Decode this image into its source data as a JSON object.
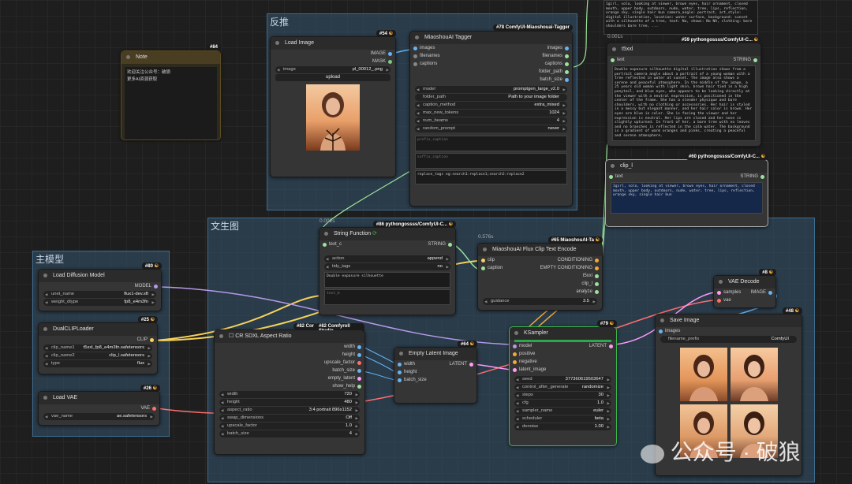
{
  "colors": {
    "group": "#34546e",
    "clip": "#f6d25a",
    "model": "#b69ae8",
    "latent": "#ff9cf9",
    "vae": "#ff6e6e",
    "string": "#9be39a",
    "image": "#64b5f6",
    "progress": "#2aa84a"
  },
  "groups": {
    "reverse": "反推",
    "txt2img": "文生图",
    "main_model": "主模型"
  },
  "note": {
    "id": "#84",
    "title": "Note",
    "line1": "欢迎关注公众号：破狼",
    "line2": "更多AI资源获取"
  },
  "load_image": {
    "id": "#54",
    "title": "Load Image",
    "out_image": "IMAGE",
    "out_mask": "MASK",
    "image_label": "image",
    "image_value": "pl_00012_.png",
    "upload": "upload"
  },
  "tagger": {
    "id": "#78 ComfyUI-Miaoshouai-Tagger",
    "title": "MiaoshouAI Tagger",
    "inputs": [
      "images",
      "filenames",
      "captions"
    ],
    "outputs": [
      "images",
      "filenames",
      "captions",
      "folder_path",
      "batch_size"
    ],
    "widgets": [
      {
        "l": "model",
        "r": "promptgen_large_v2.0"
      },
      {
        "l": "folder_path",
        "r": "Path to your image folder"
      },
      {
        "l": "caption_method",
        "r": "extra_mixed"
      },
      {
        "l": "max_new_tokens",
        "r": "1024"
      },
      {
        "l": "num_beams",
        "r": "4"
      },
      {
        "l": "random_prompt",
        "r": "never"
      }
    ],
    "prefix": "prefix_caption",
    "suffix": "suffix_caption",
    "replace": "replace_tags eg:search1:replace1;search2:replace2"
  },
  "t5xxl": {
    "time": "0.001s",
    "id": "#59 pythongossss/ComfyUI-C...",
    "title": "t5xxl",
    "in_text": "text",
    "out": "STRING",
    "top_text": "1girl, solo, looking at viewer, brown eyes, hair ornament, closed mouth, upper body, outdoors, nude, water, tree, lips, reflection, orange sky, single hair bun\n\ncamera_angle: portrait, art_style: digital illustration, location: water surface, background: sunset with a silhouette of a tree, text: No, shows: No NA, clothing: bare shoulders bare tree, ...",
    "body": "Double exposure silhouette digital illustration shows from a portrait camera angle about a portrait of a young woman with a tree reflected in water at sunset. The image also shows a serene and peaceful atmosphere. In the middle of the image, a 25 years old woman with light skin, brown hair tied in a high ponytail, and blue eyes, who appears to be looking directly at the viewer with a neutral expression, is positioned in the center of the frame. She has a slender physique and bare shoulders, with no clothing or accessories. Her hair is styled in a messy but elegant manner, and her hair color is brown. Her eyes are blue in color. She is facing the viewer and her expression is neutral. Her lips are closed and her nose is slightly upturned. In front of her, a bare tree with no leaves and no branches is reflected in the calm water. The background is a gradient of warm oranges and pinks, creating a peaceful and serene atmosphere."
  },
  "clip_l": {
    "id": "#60 pythongossss/ComfyUI-C...",
    "title": "clip_l",
    "in_text": "text",
    "out": "STRING",
    "text": "1girl, solo, looking at viewer, brown eyes, hair ornament, closed mouth, upper body, outdoors, nude, water, tree, lips, reflection, orange sky, single hair bun"
  },
  "string_fn": {
    "time": "0.002s",
    "id": "#86 pythongossss/ComfyUI-C...",
    "title": "String Function",
    "in_text": "text_c",
    "out": "STRING",
    "widgets": [
      {
        "l": "action",
        "r": "append"
      },
      {
        "l": "tidy_tags",
        "r": "no"
      }
    ],
    "text_a": "Double exposure silhouette",
    "text_b": "text_b"
  },
  "flux_encode": {
    "time": "0.576s",
    "id": "#65 MiaoshouAI-Ta",
    "title": "MiaoshouAI Flux Clip Text Encode",
    "inputs": [
      "clip",
      "caption"
    ],
    "outputs": [
      "CONDITIONING",
      "EMPTY CONDITIONING",
      "t5xxl",
      "clip_l",
      "analyze"
    ],
    "guidance_l": "guidance",
    "guidance_r": "3.5"
  },
  "load_diffusion": {
    "id": "#80",
    "title": "Load Diffusion Model",
    "out": "MODEL",
    "widgets": [
      {
        "l": "unet_name",
        "r": "flux1-dev.sft"
      },
      {
        "l": "weight_dtype",
        "r": "fp8_e4m3fn"
      }
    ]
  },
  "dual_clip": {
    "id": "#25",
    "title": "DualCLIPLoader",
    "out": "CLIP",
    "widgets": [
      {
        "l": "clip_name1",
        "r": "t5xxl_fp8_e4m3fn.safetensors"
      },
      {
        "l": "clip_name2",
        "r": "clip_l.safetensors"
      },
      {
        "l": "type",
        "r": "flux"
      }
    ]
  },
  "load_vae": {
    "id": "#26",
    "title": "Load VAE",
    "out": "VAE",
    "widgets": [
      {
        "l": "vae_name",
        "r": "ae.safetensors"
      }
    ]
  },
  "aspect": {
    "id": "#82 Cor",
    "id2": "#82 Comfyroll Studio",
    "title": "CR SDXL Aspect Ratio",
    "outputs": [
      "width",
      "height",
      "upscale_factor",
      "batch_size",
      "empty_latent",
      "show_help"
    ],
    "widgets": [
      {
        "l": "width",
        "r": "720"
      },
      {
        "l": "height",
        "r": "480"
      },
      {
        "l": "aspect_ratio",
        "r": "3:4 portrait 896x1152"
      },
      {
        "l": "swap_dimensions",
        "r": "Off"
      },
      {
        "l": "upscale_factor",
        "r": "1.0"
      },
      {
        "l": "batch_size",
        "r": "4"
      }
    ]
  },
  "empty_latent": {
    "id": "#64",
    "title": "Empty Latent Image",
    "inputs": [
      "width",
      "height",
      "batch_size"
    ],
    "out": "LATENT"
  },
  "ksampler": {
    "id": "#79",
    "title": "KSampler",
    "inputs": [
      "model",
      "positive",
      "negative",
      "latent_image"
    ],
    "out": "LATENT",
    "progress": 1.0,
    "widgets": [
      {
        "l": "seed",
        "r": "377360619503647"
      },
      {
        "l": "control_after_generate",
        "r": "randomize"
      },
      {
        "l": "steps",
        "r": "30"
      },
      {
        "l": "cfg",
        "r": "1.0"
      },
      {
        "l": "sampler_name",
        "r": "euler"
      },
      {
        "l": "scheduler",
        "r": "beta"
      },
      {
        "l": "denoise",
        "r": "1.00"
      }
    ]
  },
  "vae_decode": {
    "id": "#8",
    "title": "VAE Decode",
    "inputs": [
      "samples",
      "vae"
    ],
    "out": "IMAGE"
  },
  "save_image": {
    "id": "#48",
    "title": "Save Image",
    "in": "images",
    "prefix_l": "filename_prefix",
    "prefix_r": "ComfyUI"
  },
  "watermark": {
    "text": "公众号 · 破狼"
  }
}
